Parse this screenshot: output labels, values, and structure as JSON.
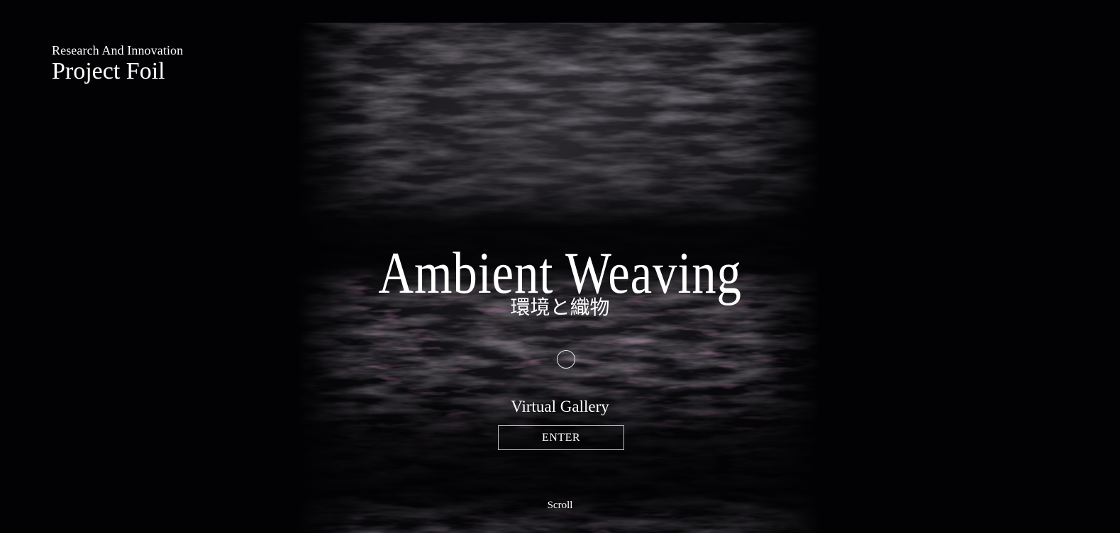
{
  "brand": {
    "subtitle": "Research And Innovation",
    "title": "Project Foil"
  },
  "hero": {
    "title": "Ambient Weaving",
    "subtitle_jp": "環境と織物"
  },
  "gallery": {
    "label": "Virtual Gallery",
    "enter_label": "ENTER"
  },
  "scroll": {
    "label": "Scroll"
  },
  "colors": {
    "background": "#020204",
    "text": "#ffffff",
    "texture_base": "#2a272c",
    "texture_accent": "#6a3a5a"
  },
  "icons": {
    "marker": "circle-icon"
  }
}
